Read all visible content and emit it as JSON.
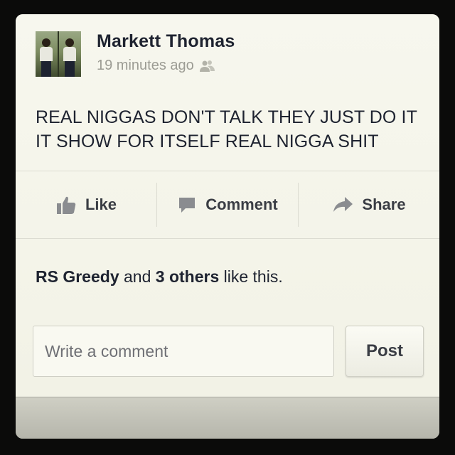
{
  "post": {
    "author": "Markett Thomas",
    "timestamp": "19 minutes ago",
    "audience_icon": "friends-icon",
    "text": "REAL NIGGAS DON'T TALK THEY JUST DO IT IT SHOW FOR ITSELF REAL NIGGA SHIT"
  },
  "actions": {
    "like": {
      "label": "Like",
      "icon": "thumbs-up-icon"
    },
    "comment": {
      "label": "Comment",
      "icon": "speech-bubble-icon"
    },
    "share": {
      "label": "Share",
      "icon": "share-arrow-icon"
    }
  },
  "likes": {
    "first_name": "RS Greedy",
    "and": "and",
    "others": "3 others",
    "suffix": "like this."
  },
  "composer": {
    "placeholder": "Write a comment",
    "value": "",
    "post_label": "Post"
  },
  "colors": {
    "background": "#f4f4ea",
    "text": "#1e2330",
    "muted": "#9c9c94",
    "frame": "#0b0b0a"
  }
}
